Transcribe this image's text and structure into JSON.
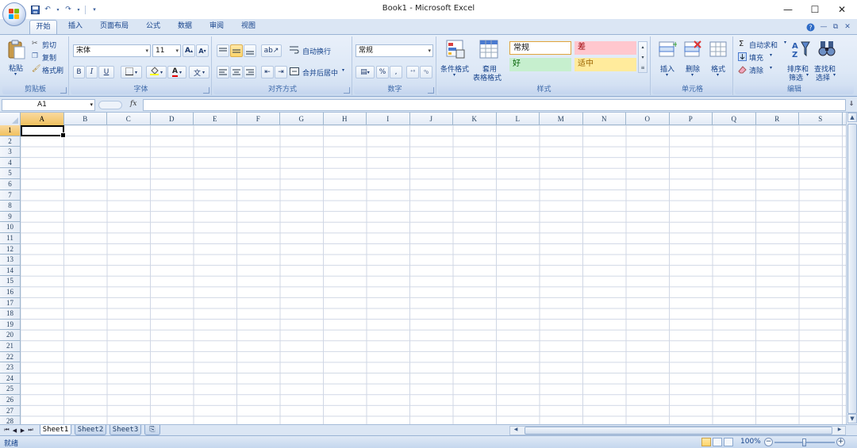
{
  "window": {
    "title": "Book1 - Microsoft Excel",
    "minimize": "—",
    "maximize": "☐",
    "close": "✕"
  },
  "tabs": [
    "开始",
    "插入",
    "页面布局",
    "公式",
    "数据",
    "审阅",
    "视图"
  ],
  "clipboard": {
    "paste": "粘贴",
    "cut": "剪切",
    "copy": "复制",
    "format_painter": "格式刷",
    "label": "剪贴板"
  },
  "font": {
    "name": "宋体",
    "size": "11",
    "grow": "A",
    "shrink": "A",
    "bold": "B",
    "italic": "I",
    "underline": "U",
    "font_color": "A",
    "phonetic": "文",
    "label": "字体"
  },
  "alignment": {
    "wrap": "自动换行",
    "merge": "合并后居中",
    "label": "对齐方式"
  },
  "number": {
    "format": "常规",
    "percent": "%",
    "comma": ",",
    "label": "数字"
  },
  "styles": {
    "conditional": "条件格式",
    "table1": "套用",
    "table2": "表格格式",
    "normal": "常规",
    "bad": "差",
    "good": "好",
    "neutral": "适中",
    "label": "样式"
  },
  "cells_group": {
    "insert": "插入",
    "delete": "删除",
    "format": "格式",
    "label": "单元格"
  },
  "editing": {
    "autosum": "自动求和",
    "fill": "填充",
    "clear": "清除",
    "sort1": "排序和",
    "sort2": "筛选",
    "find1": "查找和",
    "find2": "选择",
    "label": "编辑"
  },
  "formula_bar": {
    "name_box": "A1",
    "fx": "fx",
    "formula": ""
  },
  "columns": [
    "A",
    "B",
    "C",
    "D",
    "E",
    "F",
    "G",
    "H",
    "I",
    "J",
    "K",
    "L",
    "M",
    "N",
    "O",
    "P",
    "Q",
    "R",
    "S"
  ],
  "rows": [
    "1",
    "2",
    "3",
    "4",
    "5",
    "6",
    "7",
    "8",
    "9",
    "10",
    "11",
    "12",
    "13",
    "14",
    "15",
    "16",
    "17",
    "18",
    "19",
    "20",
    "21",
    "22",
    "23",
    "24",
    "25",
    "26",
    "27",
    "28"
  ],
  "sheets": [
    "Sheet1",
    "Sheet2",
    "Sheet3"
  ],
  "status": {
    "ready": "就绪",
    "zoom": "100%",
    "zoom_out": "−",
    "zoom_in": "+"
  },
  "colors": {
    "accent": "#15428b",
    "selected_header": "#f1c15f",
    "bad_fill": "#ffc7ce",
    "bad_text": "#9c0006",
    "good_fill": "#c6efce",
    "good_text": "#006100",
    "neutral_fill": "#ffeb9c",
    "neutral_text": "#9c6500"
  }
}
